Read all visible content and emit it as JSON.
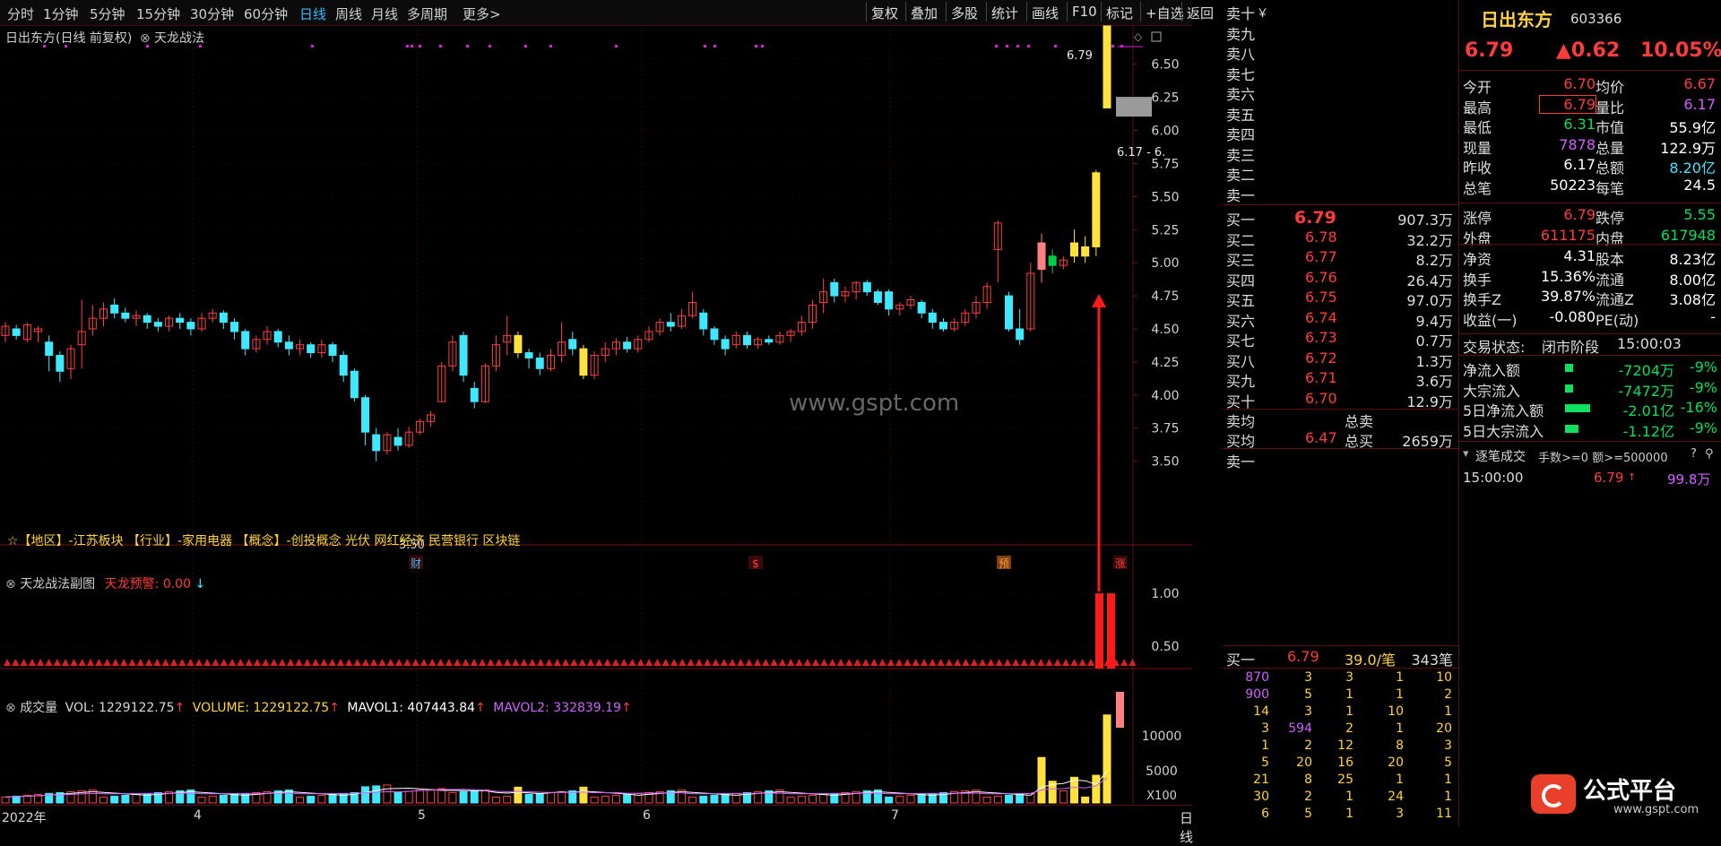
{
  "toolbar": {
    "periods": [
      "分时",
      "1分钟",
      "5分钟",
      "15分钟",
      "30分钟",
      "60分钟",
      "日线",
      "周线",
      "月线",
      "多周期",
      "更多>"
    ],
    "active_period": "日线",
    "actions": [
      "复权",
      "叠加",
      "多股",
      "统计",
      "画线",
      "F10",
      "标记",
      "+自选",
      "返回"
    ]
  },
  "chart_header": {
    "stock_title": "日出东方(日线 前复权)",
    "indicator_name": "天龙战法",
    "last_price_label": "6.79",
    "range_label": "6.17 - 6.",
    "low_label": "3.50"
  },
  "price_axis": [
    "6.50",
    "6.25",
    "6.00",
    "5.75",
    "5.50",
    "5.25",
    "5.00",
    "4.75",
    "4.50",
    "4.25",
    "4.00",
    "3.75",
    "3.50"
  ],
  "info_line": "☆【地区】-江苏板块  【行业】-家用电器  【概念】-创投概念 光伏 网红经济 民营银行 区块链",
  "event_marks": [
    {
      "text": "财",
      "color": "#3ab8ff"
    },
    {
      "text": "$",
      "color": "#ff3b3b"
    },
    {
      "text": "预",
      "color": "#ff9a2a"
    },
    {
      "text": "涨",
      "color": "#ff3b3b"
    }
  ],
  "watermark": "www.gspt.com",
  "sub_panel": {
    "title": "天龙战法副图",
    "signal_label": "天龙预警:",
    "signal_value": "0.00",
    "axis": [
      "1.00",
      "0.50"
    ]
  },
  "volume_panel": {
    "title": "成交量",
    "vol_label": "VOL: 1229122.75",
    "volume_label": "VOLUME: 1229122.75",
    "mavol1_label": "MAVOL1: 407443.84",
    "mavol2_label": "MAVOL2: 332839.19",
    "axis": [
      "10000",
      "5000"
    ],
    "unit": "X100"
  },
  "date_axis": [
    "2022年",
    "4",
    "5",
    "6",
    "7"
  ],
  "period_tag": "日线",
  "order_book": {
    "sell_labels": [
      "卖十",
      "卖九",
      "卖八",
      "卖七",
      "卖六",
      "卖五",
      "卖四",
      "卖三",
      "卖二",
      "卖一"
    ],
    "currency_mark": "￥",
    "buy": [
      {
        "label": "买一",
        "price": "6.79",
        "vol": "907.3万"
      },
      {
        "label": "买二",
        "price": "6.78",
        "vol": "32.2万"
      },
      {
        "label": "买三",
        "price": "6.77",
        "vol": "8.2万"
      },
      {
        "label": "买四",
        "price": "6.76",
        "vol": "26.4万"
      },
      {
        "label": "买五",
        "price": "6.75",
        "vol": "97.0万"
      },
      {
        "label": "买六",
        "price": "6.74",
        "vol": "9.4万"
      },
      {
        "label": "买七",
        "price": "6.73",
        "vol": "0.7万"
      },
      {
        "label": "买八",
        "price": "6.72",
        "vol": "1.3万"
      },
      {
        "label": "买九",
        "price": "6.71",
        "vol": "3.6万"
      },
      {
        "label": "买十",
        "price": "6.70",
        "vol": "12.9万"
      }
    ],
    "sell_avg_label": "卖均",
    "sell_total_label": "总卖",
    "buy_avg_label": "买均",
    "buy_avg": "6.47",
    "buy_total_label": "总买",
    "buy_total": "2659万",
    "sell_one_label": "卖一",
    "queue_header": {
      "label": "买一",
      "price": "6.79",
      "per": "39.0/笔",
      "count": "343笔"
    },
    "queue": [
      [
        "870",
        "3",
        "3",
        "1",
        "10"
      ],
      [
        "900",
        "5",
        "1",
        "1",
        "2"
      ],
      [
        "14",
        "3",
        "1",
        "10",
        "1"
      ],
      [
        "3",
        "594",
        "2",
        "1",
        "20"
      ],
      [
        "1",
        "2",
        "12",
        "8",
        "3"
      ],
      [
        "5",
        "20",
        "16",
        "20",
        "5"
      ],
      [
        "21",
        "8",
        "25",
        "1",
        "1"
      ],
      [
        "30",
        "2",
        "1",
        "24",
        "1"
      ],
      [
        "6",
        "5",
        "1",
        "3",
        "11"
      ]
    ]
  },
  "quote": {
    "name": "日出东方",
    "code": "603366",
    "price": "6.79",
    "change": "▲0.62",
    "change_pct": "10.05%",
    "rows": [
      {
        "l1": "今开",
        "v1": "6.70",
        "l2": "均价",
        "v2": "6.67"
      },
      {
        "l1": "最高",
        "v1": "6.79",
        "l2": "量比",
        "v2": "6.17"
      },
      {
        "l1": "最低",
        "v1": "6.31",
        "l2": "市值",
        "v2": "55.9亿"
      },
      {
        "l1": "现量",
        "v1": "7878",
        "l2": "总量",
        "v2": "122.9万"
      },
      {
        "l1": "昨收",
        "v1": "6.17",
        "l2": "总额",
        "v2": "8.20亿"
      },
      {
        "l1": "总笔",
        "v1": "50223",
        "l2": "每笔",
        "v2": "24.5"
      }
    ],
    "rows2": [
      {
        "l1": "涨停",
        "v1": "6.79",
        "l2": "跌停",
        "v2": "5.55"
      },
      {
        "l1": "外盘",
        "v1": "611175",
        "l2": "内盘",
        "v2": "617948"
      }
    ],
    "rows3": [
      {
        "l1": "净资",
        "v1": "4.31",
        "l2": "股本",
        "v2": "8.23亿"
      },
      {
        "l1": "换手",
        "v1": "15.36%",
        "l2": "流通",
        "v2": "8.00亿"
      },
      {
        "l1": "换手Z",
        "v1": "39.87%",
        "l2": "流通Z",
        "v2": "3.08亿"
      },
      {
        "l1": "收益(一)",
        "v1": "-0.080",
        "l2": "PE(动)",
        "v2": "-"
      }
    ],
    "trade_state_label": "交易状态:",
    "trade_state": "闭市阶段",
    "trade_time": "15:00:03",
    "flows": [
      {
        "label": "净流入额",
        "value": "-7204万",
        "pct": "-9%",
        "bar": 0.08
      },
      {
        "label": "大宗流入",
        "value": "-7472万",
        "pct": "-9%",
        "bar": 0.08
      },
      {
        "label": "5日净流入额",
        "value": "-2.01亿",
        "pct": "-16%",
        "bar": 0.26
      },
      {
        "label": "5日大宗流入",
        "value": "-1.12亿",
        "pct": "-9%",
        "bar": 0.14
      }
    ],
    "ticks_title": "逐笔成交",
    "ticks_filter": "手数>=0 额>=500000",
    "tick": {
      "time": "15:00:00",
      "price": "6.79",
      "arrow": "↑",
      "vol": "99.8万"
    }
  },
  "brand": {
    "logo_text": "公式平台",
    "url": "www.gspt.com"
  },
  "chart_data": {
    "type": "candlestick",
    "y_range": [
      3.5,
      6.6
    ],
    "candles": [
      [
        4.45,
        4.52,
        4.4,
        4.55
      ],
      [
        4.5,
        4.45,
        4.42,
        4.53
      ],
      [
        4.42,
        4.53,
        4.4,
        4.55
      ],
      [
        4.48,
        4.5,
        4.4,
        4.52
      ],
      [
        4.4,
        4.3,
        4.18,
        4.45
      ],
      [
        4.3,
        4.18,
        4.1,
        4.33
      ],
      [
        4.2,
        4.35,
        4.12,
        4.38
      ],
      [
        4.38,
        4.48,
        4.2,
        4.72
      ],
      [
        4.5,
        4.58,
        4.45,
        4.68
      ],
      [
        4.58,
        4.65,
        4.52,
        4.7
      ],
      [
        4.68,
        4.62,
        4.58,
        4.73
      ],
      [
        4.62,
        4.58,
        4.55,
        4.66
      ],
      [
        4.58,
        4.6,
        4.52,
        4.64
      ],
      [
        4.6,
        4.55,
        4.5,
        4.62
      ],
      [
        4.55,
        4.52,
        4.48,
        4.58
      ],
      [
        4.52,
        4.58,
        4.48,
        4.6
      ],
      [
        4.58,
        4.55,
        4.5,
        4.62
      ],
      [
        4.55,
        4.5,
        4.45,
        4.58
      ],
      [
        4.5,
        4.58,
        4.48,
        4.62
      ],
      [
        4.58,
        4.62,
        4.55,
        4.65
      ],
      [
        4.62,
        4.55,
        4.5,
        4.64
      ],
      [
        4.55,
        4.48,
        4.42,
        4.58
      ],
      [
        4.48,
        4.35,
        4.3,
        4.5
      ],
      [
        4.35,
        4.42,
        4.32,
        4.45
      ],
      [
        4.42,
        4.48,
        4.38,
        4.52
      ],
      [
        4.48,
        4.4,
        4.36,
        4.5
      ],
      [
        4.4,
        4.35,
        4.3,
        4.45
      ],
      [
        4.35,
        4.38,
        4.3,
        4.42
      ],
      [
        4.38,
        4.32,
        4.28,
        4.4
      ],
      [
        4.32,
        4.38,
        4.28,
        4.42
      ],
      [
        4.38,
        4.3,
        4.25,
        4.4
      ],
      [
        4.3,
        4.15,
        4.1,
        4.33
      ],
      [
        4.18,
        3.98,
        3.95,
        4.2
      ],
      [
        3.98,
        3.72,
        3.62,
        4.0
      ],
      [
        3.7,
        3.58,
        3.5,
        3.75
      ],
      [
        3.58,
        3.7,
        3.55,
        3.72
      ],
      [
        3.68,
        3.62,
        3.58,
        3.75
      ],
      [
        3.62,
        3.72,
        3.6,
        3.76
      ],
      [
        3.72,
        3.8,
        3.7,
        3.82
      ],
      [
        3.8,
        3.85,
        3.76,
        3.88
      ],
      [
        3.95,
        4.22,
        3.95,
        4.25
      ],
      [
        4.22,
        4.4,
        4.18,
        4.45
      ],
      [
        4.45,
        4.15,
        4.1,
        4.48
      ],
      [
        4.05,
        3.95,
        3.9,
        4.1
      ],
      [
        3.95,
        4.22,
        3.94,
        4.24
      ],
      [
        4.22,
        4.38,
        4.18,
        4.45
      ],
      [
        4.4,
        4.45,
        4.3,
        4.6
      ],
      [
        4.45,
        4.32,
        4.28,
        4.48
      ],
      [
        4.32,
        4.28,
        4.2,
        4.35
      ],
      [
        4.28,
        4.2,
        4.15,
        4.32
      ],
      [
        4.2,
        4.3,
        4.18,
        4.35
      ],
      [
        4.3,
        4.4,
        4.25,
        4.55
      ],
      [
        4.42,
        4.35,
        4.3,
        4.48
      ],
      [
        4.35,
        4.15,
        4.12,
        4.38
      ],
      [
        4.15,
        4.3,
        4.12,
        4.33
      ],
      [
        4.3,
        4.35,
        4.25,
        4.4
      ],
      [
        4.35,
        4.4,
        4.3,
        4.43
      ],
      [
        4.4,
        4.35,
        4.32,
        4.44
      ],
      [
        4.35,
        4.42,
        4.32,
        4.45
      ],
      [
        4.42,
        4.48,
        4.4,
        4.52
      ],
      [
        4.48,
        4.55,
        4.45,
        4.58
      ],
      [
        4.55,
        4.52,
        4.48,
        4.62
      ],
      [
        4.52,
        4.6,
        4.5,
        4.65
      ],
      [
        4.6,
        4.7,
        4.58,
        4.78
      ],
      [
        4.62,
        4.5,
        4.45,
        4.65
      ],
      [
        4.5,
        4.42,
        4.38,
        4.52
      ],
      [
        4.42,
        4.35,
        4.3,
        4.45
      ],
      [
        4.38,
        4.45,
        4.35,
        4.48
      ],
      [
        4.45,
        4.38,
        4.35,
        4.48
      ],
      [
        4.38,
        4.42,
        4.35,
        4.44
      ],
      [
        4.42,
        4.4,
        4.38,
        4.45
      ],
      [
        4.4,
        4.45,
        4.38,
        4.48
      ],
      [
        4.45,
        4.48,
        4.4,
        4.5
      ],
      [
        4.48,
        4.55,
        4.45,
        4.6
      ],
      [
        4.55,
        4.68,
        4.5,
        4.72
      ],
      [
        4.7,
        4.78,
        4.62,
        4.88
      ],
      [
        4.85,
        4.75,
        4.7,
        4.88
      ],
      [
        4.75,
        4.78,
        4.7,
        4.82
      ],
      [
        4.78,
        4.85,
        4.72,
        4.86
      ],
      [
        4.85,
        4.78,
        4.75,
        4.87
      ],
      [
        4.78,
        4.7,
        4.68,
        4.8
      ],
      [
        4.78,
        4.65,
        4.6,
        4.8
      ],
      [
        4.65,
        4.68,
        4.6,
        4.7
      ],
      [
        4.68,
        4.72,
        4.65,
        4.75
      ],
      [
        4.7,
        4.62,
        4.58,
        4.72
      ],
      [
        4.62,
        4.55,
        4.5,
        4.65
      ],
      [
        4.55,
        4.5,
        4.48,
        4.58
      ],
      [
        4.5,
        4.55,
        4.48,
        4.58
      ],
      [
        4.55,
        4.62,
        4.52,
        4.65
      ],
      [
        4.62,
        4.7,
        4.58,
        4.75
      ],
      [
        4.7,
        4.82,
        4.65,
        4.85
      ],
      [
        5.1,
        5.3,
        4.85,
        5.32
      ],
      [
        4.75,
        4.5,
        4.48,
        4.78
      ],
      [
        4.5,
        4.42,
        4.38,
        4.65
      ],
      [
        4.5,
        4.92,
        4.48,
        5.0
      ],
      [
        4.95,
        5.15,
        4.85,
        5.22
      ],
      [
        5.05,
        4.98,
        4.92,
        5.1
      ],
      [
        4.98,
        5.02,
        4.95,
        5.05
      ],
      [
        5.05,
        5.15,
        5.0,
        5.25
      ],
      [
        5.12,
        5.05,
        5.0,
        5.2
      ],
      [
        5.12,
        5.68,
        5.05,
        5.7
      ],
      [
        6.17,
        6.79,
        6.31,
        6.79
      ]
    ]
  }
}
